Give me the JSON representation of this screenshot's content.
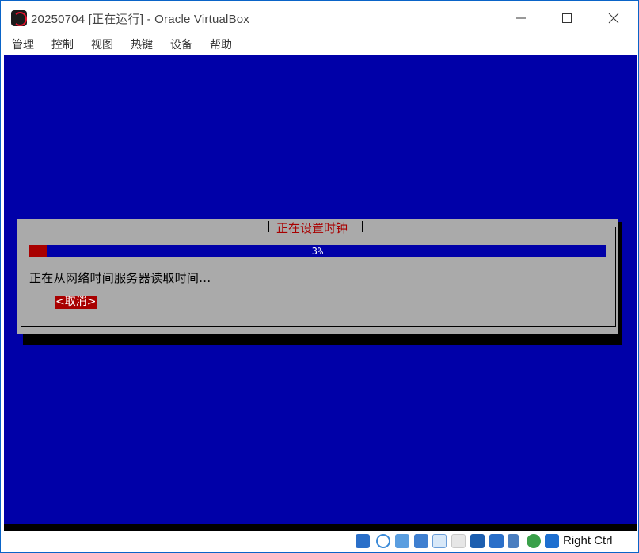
{
  "window": {
    "title": "20250704 [正在运行] - Oracle VirtualBox",
    "controls": {
      "minimize": "—",
      "maximize": "☐",
      "close": "✕"
    }
  },
  "menu": {
    "items": [
      {
        "label": "管理"
      },
      {
        "label": "控制"
      },
      {
        "label": "视图"
      },
      {
        "label": "热键"
      },
      {
        "label": "设备"
      },
      {
        "label": "帮助"
      }
    ]
  },
  "dialog": {
    "title": "正在设置时钟",
    "progress_label": "3%",
    "progress_value": 0.03,
    "message": "正在从网络时间服务器读取时间...",
    "cancel_label": "<取消>"
  },
  "statusbar": {
    "icons": [
      "hard-disk-icon",
      "optical-drive-icon",
      "audio-icon",
      "network-icon",
      "usb-icon",
      "shared-folders-icon",
      "display-icon",
      "recording-icon",
      "virtualization-icon",
      "cpu-activity-icon",
      "mouse-integration-icon"
    ],
    "host_key": "Right Ctrl"
  },
  "colors": {
    "vm_background": "#0000a8",
    "dialog_background": "#aaaaaa",
    "accent_red": "#a80000",
    "window_border": "#0a64c8"
  }
}
